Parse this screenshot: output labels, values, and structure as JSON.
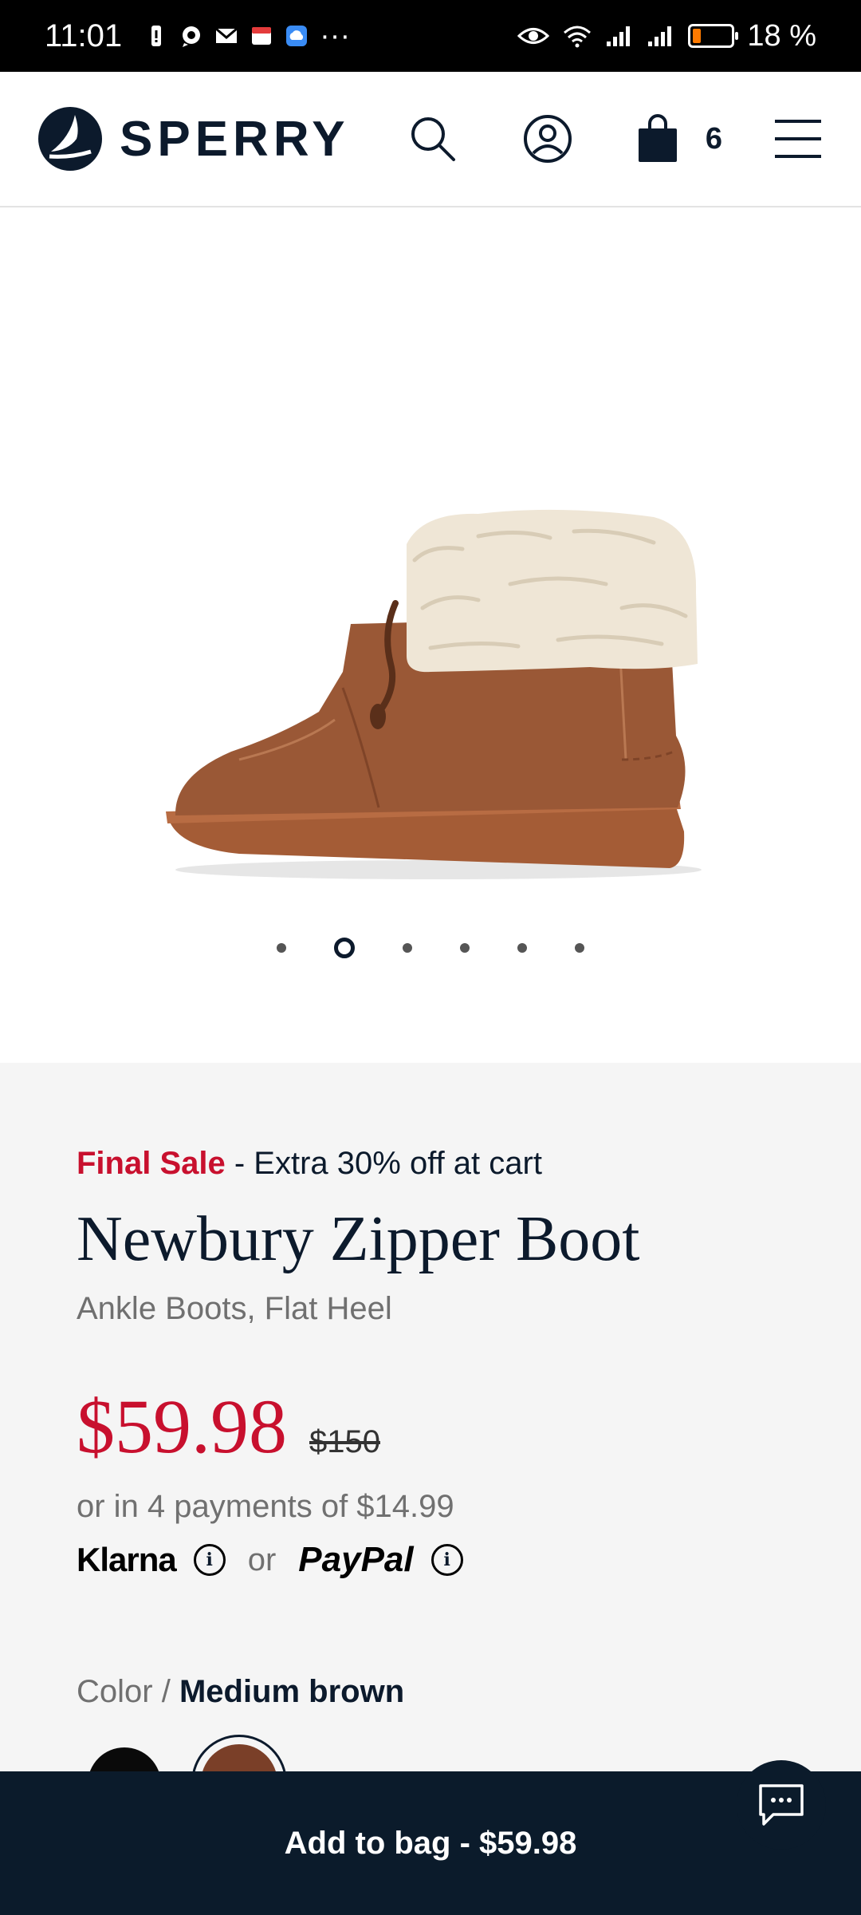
{
  "status_bar": {
    "time": "11:01",
    "more": "···",
    "battery": "18 %",
    "battery_level": 0.18
  },
  "header": {
    "brand": "SPERRY",
    "bag_count": "6"
  },
  "gallery": {
    "image_alt": "Newbury Zipper Boot, medium brown suede with shearling cuff",
    "active_index": 1,
    "total": 6
  },
  "product": {
    "sale_label": "Final Sale",
    "sale_extra": " - Extra 30% off at cart",
    "name": "Newbury Zipper Boot",
    "category": "Ankle Boots, Flat Heel",
    "price": "$59.98",
    "original_price": "$150",
    "installments": "or in 4 payments of $14.99",
    "klarna": "Klarna",
    "or": "or",
    "paypal": "PayPal",
    "info_glyph": "i",
    "color_label": "Color /",
    "color_value": "Medium brown",
    "swatches": [
      {
        "name": "Black",
        "color": "#0a0a0a"
      },
      {
        "name": "Medium brown",
        "color": "#7a3f28"
      }
    ]
  },
  "cta": {
    "add_to_bag": "Add to bag - $59.98"
  },
  "colors": {
    "brand_navy": "#0c1a2c",
    "sale_red": "#c8102e"
  }
}
